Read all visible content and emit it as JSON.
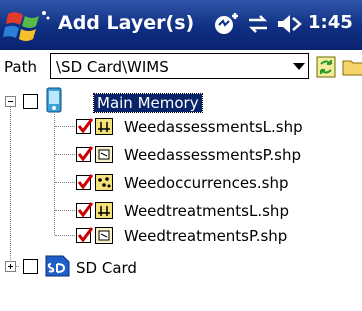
{
  "titlebar": {
    "title": "Add Layer(s)",
    "clock": "1:45"
  },
  "path": {
    "label": "Path",
    "value": "\\SD Card\\WIMS"
  },
  "tree": {
    "root": {
      "label": "Main Memory",
      "checked": false,
      "expanded": true,
      "selected": true
    },
    "layers": [
      {
        "label": "WeedassessmentsL.shp",
        "checked": true,
        "icon": "line-layer-icon"
      },
      {
        "label": "WeedassessmentsP.shp",
        "checked": true,
        "icon": "polygon-layer-icon"
      },
      {
        "label": "Weedoccurrences.shp",
        "checked": true,
        "icon": "point-layer-icon"
      },
      {
        "label": "WeedtreatmentsL.shp",
        "checked": true,
        "icon": "line-layer-icon"
      },
      {
        "label": "WeedtreatmentsP.shp",
        "checked": true,
        "icon": "polygon-layer-icon"
      }
    ],
    "sd_card": {
      "label": "SD Card",
      "checked": false,
      "expanded": false
    }
  },
  "colors": {
    "titlebar": "#0f2f82",
    "selection": "#0a246a",
    "check": "#cc0000"
  }
}
